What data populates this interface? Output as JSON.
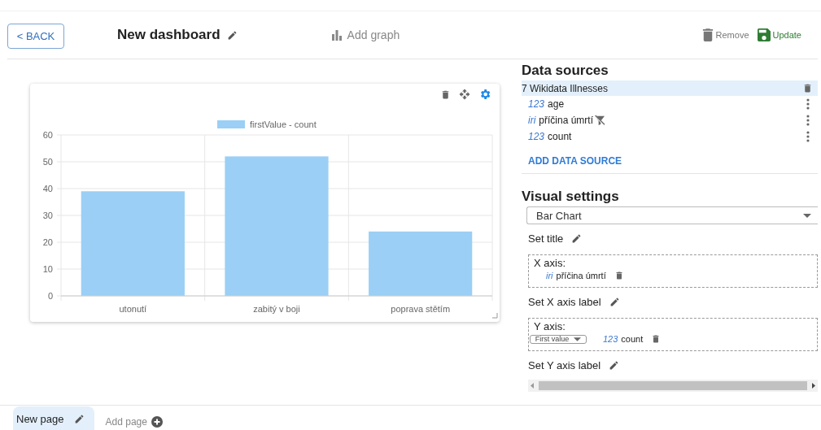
{
  "header": {
    "back": "< BACK",
    "title": "New dashboard",
    "add_graph": "Add graph",
    "remove": "Remove",
    "update": "Update"
  },
  "chart_card": {
    "chart_data": {
      "type": "bar",
      "categories": [
        "utonutí",
        "zabitý v boji",
        "poprava stětím"
      ],
      "series": [
        {
          "name": "firstValue - count",
          "color": "#9bcff5",
          "values": [
            39,
            52,
            24
          ]
        }
      ],
      "ylim": [
        0,
        60
      ],
      "grid": true,
      "yticks": [
        0,
        10,
        20,
        30,
        40,
        50,
        60
      ]
    }
  },
  "data_sources": {
    "title": "Data sources",
    "sources": [
      {
        "name": "7 Wikidata Illnesses",
        "selected": true,
        "fields": [
          {
            "type": "123",
            "name": "age",
            "filtered": false
          },
          {
            "type": "iri",
            "name": "příčina úmrtí",
            "filtered": true
          },
          {
            "type": "123",
            "name": "count",
            "filtered": false
          }
        ]
      }
    ],
    "add": "ADD DATA SOURCE"
  },
  "visual_settings": {
    "title": "Visual settings",
    "chart_type": "Bar Chart",
    "set_title": "Set title",
    "x_axis": {
      "label": "X axis:",
      "field_type": "iri",
      "field": "příčina úmrtí"
    },
    "set_x_label": "Set X axis label",
    "y_axis": {
      "label": "Y axis:",
      "aggregate": "First value",
      "field_type": "123",
      "field": "count"
    },
    "set_y_label": "Set Y axis label"
  },
  "pages": [
    {
      "label": "New page",
      "selected": true
    }
  ],
  "add_page": "Add page"
}
